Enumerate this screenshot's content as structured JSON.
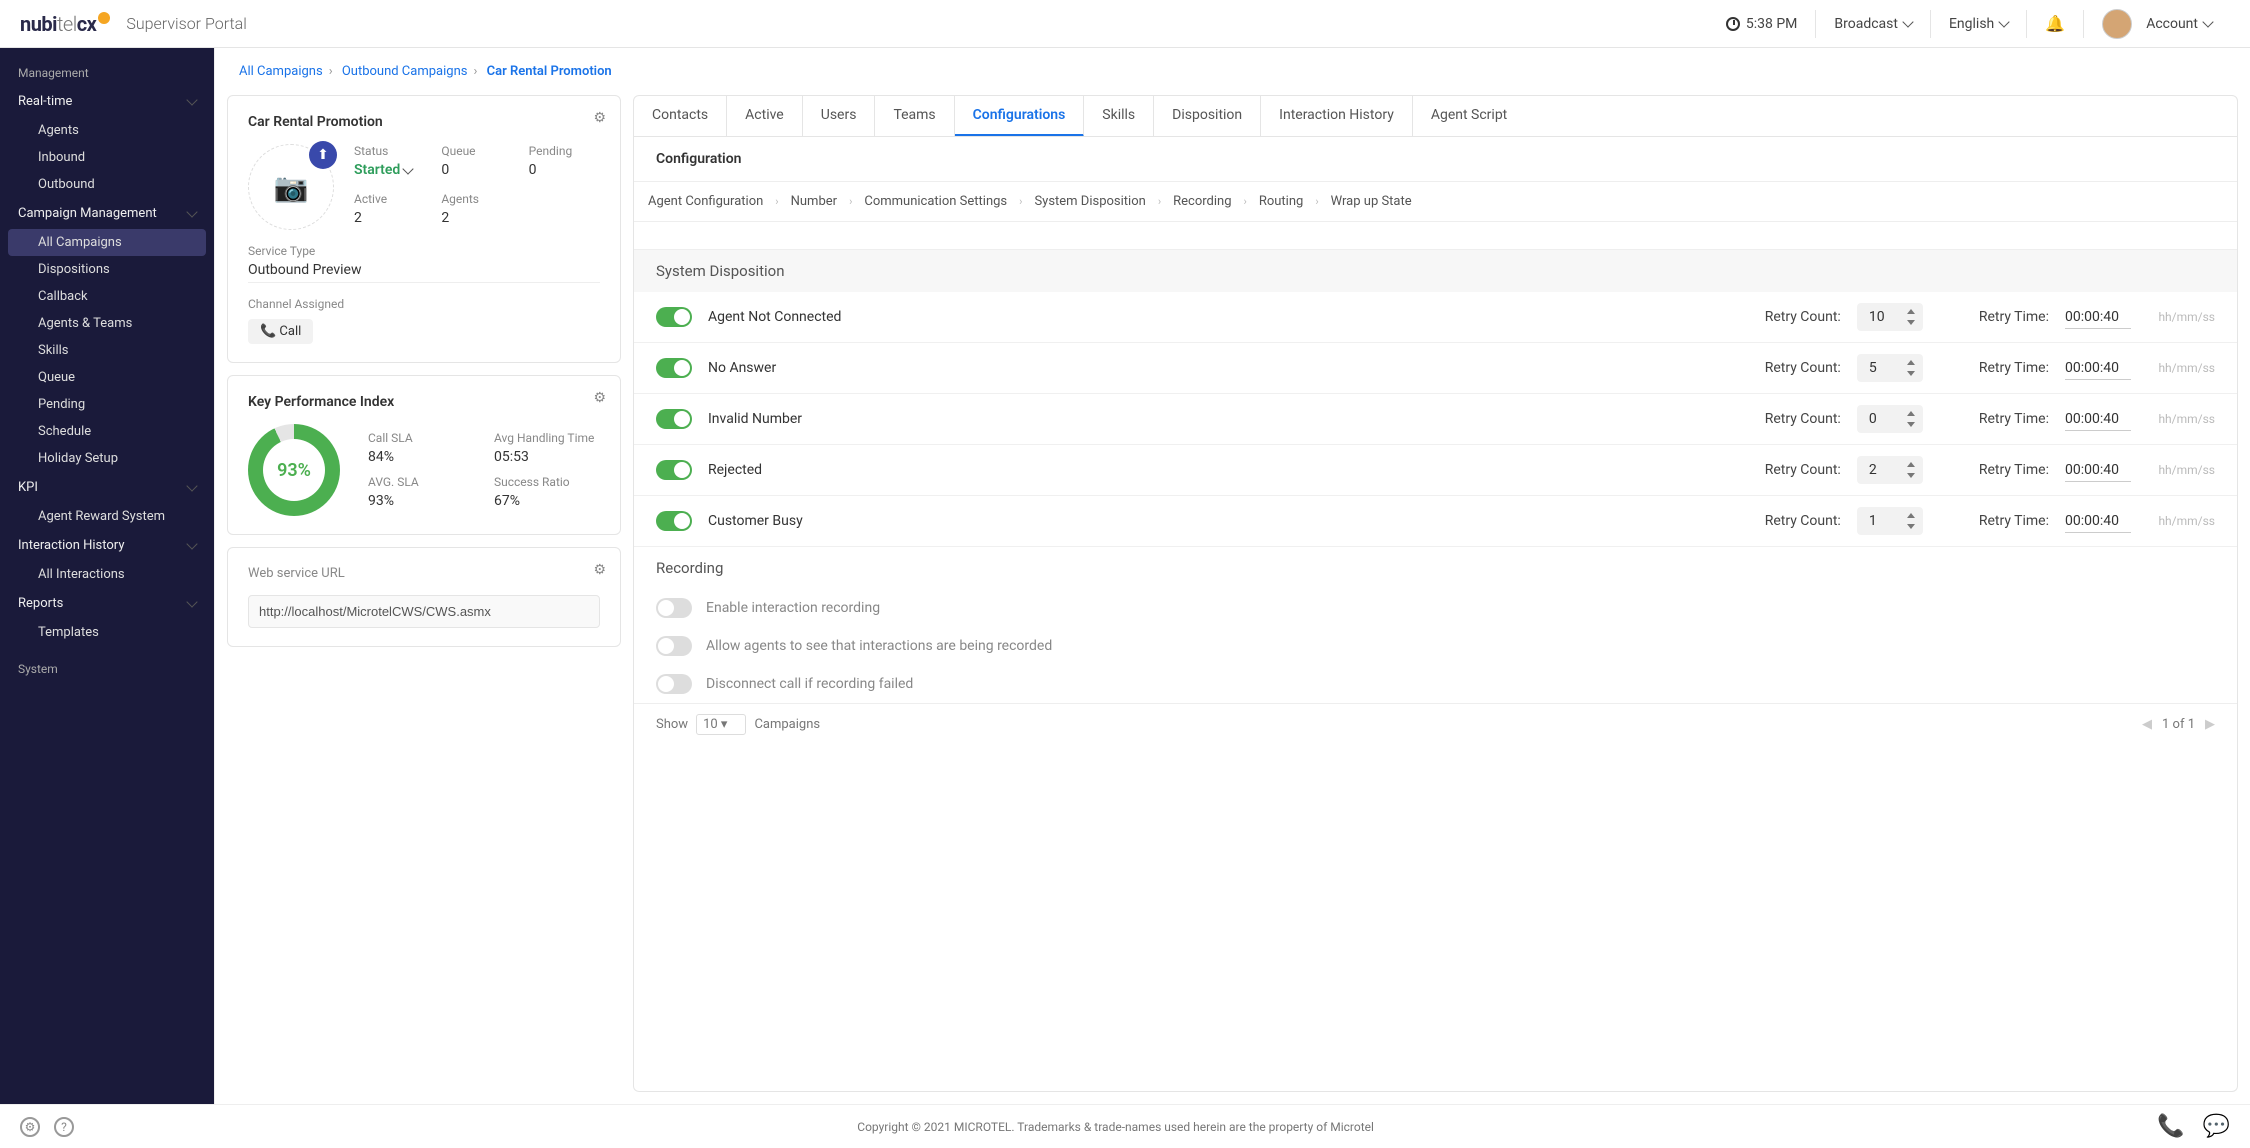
{
  "header": {
    "portal_label": "Supervisor Portal",
    "time": "5:38 PM",
    "broadcast": "Broadcast",
    "language": "English",
    "account": "Account"
  },
  "sidebar": {
    "management_label": "Management",
    "sections": [
      {
        "label": "Real-time",
        "items": [
          "Agents",
          "Inbound",
          "Outbound"
        ]
      },
      {
        "label": "Campaign Management",
        "items": [
          "All Campaigns",
          "Dispositions",
          "Callback",
          "Agents & Teams",
          "Skills",
          "Queue",
          "Pending",
          "Schedule",
          "Holiday Setup"
        ],
        "active": "All Campaigns"
      },
      {
        "label": "KPI",
        "items": [
          "Agent Reward System"
        ]
      },
      {
        "label": "Interaction History",
        "items": [
          "All Interactions"
        ]
      },
      {
        "label": "Reports",
        "items": [
          "Templates"
        ]
      }
    ],
    "system_label": "System"
  },
  "breadcrumb": {
    "all": "All Campaigns",
    "mid": "Outbound Campaigns",
    "current": "Car Rental Promotion"
  },
  "campaign": {
    "title": "Car Rental Promotion",
    "status_label": "Status",
    "status_value": "Started",
    "queue_label": "Queue",
    "queue_value": "0",
    "pending_label": "Pending",
    "pending_value": "0",
    "active_label": "Active",
    "active_value": "2",
    "agents_label": "Agents",
    "agents_value": "2",
    "service_type_label": "Service Type",
    "service_type_value": "Outbound Preview",
    "channel_label": "Channel Assigned",
    "channel_value": "Call"
  },
  "kpi": {
    "title": "Key Performance Index",
    "ring": "93%",
    "call_sla_label": "Call SLA",
    "call_sla": "84%",
    "aht_label": "Avg Handling Time",
    "aht": "05:53",
    "avg_sla_label": "AVG. SLA",
    "avg_sla": "93%",
    "sr_label": "Success Ratio",
    "sr": "67%"
  },
  "web": {
    "title": "Web service URL",
    "value": "http://localhost/MicrotelCWS/CWS.asmx"
  },
  "tabs": [
    "Contacts",
    "Active",
    "Users",
    "Teams",
    "Configurations",
    "Skills",
    "Disposition",
    "Interaction History",
    "Agent Script"
  ],
  "active_tab": "Configurations",
  "conf": {
    "title": "Configuration",
    "subtabs": [
      "Agent Configuration",
      "Number",
      "Communication Settings",
      "System Disposition",
      "Recording",
      "Routing",
      "Wrap up State"
    ],
    "sd_title": "System Disposition",
    "rows": [
      {
        "name": "Agent Not Connected",
        "count_label": "Retry Count:",
        "count": "10",
        "time_label": "Retry Time:",
        "time": "00:00:40",
        "hint": "hh/mm/ss"
      },
      {
        "name": "No Answer",
        "count_label": "Retry Count:",
        "count": "5",
        "time_label": "Retry Time:",
        "time": "00:00:40",
        "hint": "hh/mm/ss"
      },
      {
        "name": "Invalid Number",
        "count_label": "Retry Count:",
        "count": "0",
        "time_label": "Retry Time:",
        "time": "00:00:40",
        "hint": "hh/mm/ss"
      },
      {
        "name": "Rejected",
        "count_label": "Retry Count:",
        "count": "2",
        "time_label": "Retry Time:",
        "time": "00:00:40",
        "hint": "hh/mm/ss"
      },
      {
        "name": "Customer Busy",
        "count_label": "Retry Count:",
        "count": "1",
        "time_label": "Retry Time:",
        "time": "00:00:40",
        "hint": "hh/mm/ss"
      }
    ],
    "rec_title": "Recording",
    "rec_rows": [
      "Enable interaction recording",
      "Allow agents to see that interactions are being recorded",
      "Disconnect call if recording failed"
    ]
  },
  "pager": {
    "show": "Show",
    "n": "10",
    "unit": "Campaigns",
    "page": "1 of 1"
  },
  "footer": {
    "copy": "Copyright © 2021 MICROTEL. Trademarks & trade-names used herein are the property of Microtel"
  }
}
